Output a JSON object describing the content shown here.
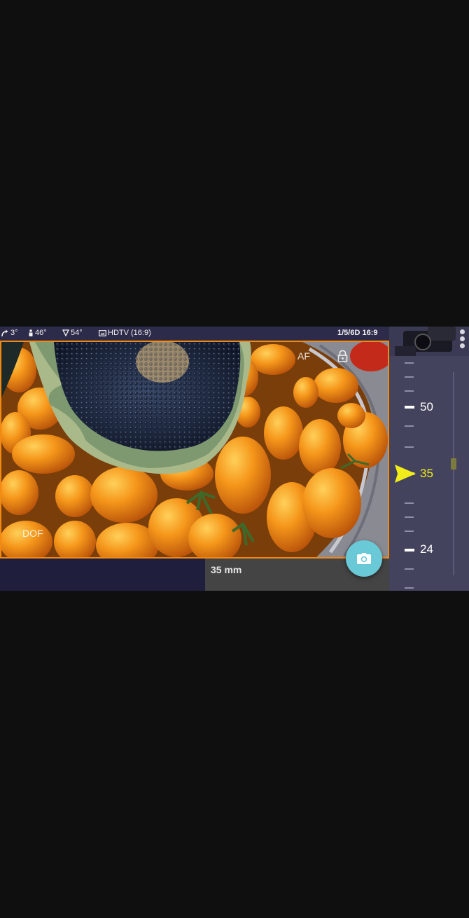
{
  "status_bar": {
    "tilt": "3°",
    "person_angle": "46°",
    "fov": "54°",
    "aspect_format": "HDTV (16:9)",
    "camera_ratio": "1/5/6D 16:9"
  },
  "viewfinder": {
    "af_label": "AF",
    "dof_label": "DOF",
    "focal_length_label": "35 mm"
  },
  "zoom_scale": {
    "labels": [
      "50",
      "35",
      "24"
    ],
    "active": "35"
  },
  "colors": {
    "viewfinder_border": "#f28a12",
    "shutter_button": "#6ac9d6",
    "active_marker": "#f2ec1a",
    "panel": "#43435d"
  },
  "icons": {
    "tilt": "curved-arrow-icon",
    "person": "person-icon",
    "fov": "triangle-fov-icon",
    "aspect": "frame-icon",
    "lock": "lock-icon",
    "camera": "camera-icon",
    "menu": "overflow-menu-icon",
    "pointer": "zoom-pointer-icon"
  }
}
